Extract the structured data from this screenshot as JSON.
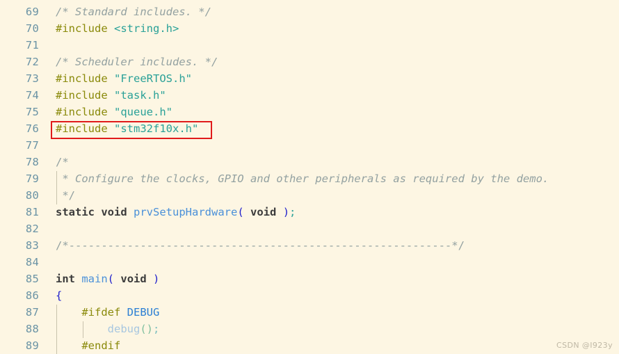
{
  "editor": {
    "background_color": "#fdf6e3",
    "gutter_color": "#6a93a5",
    "highlight_color": "#e01b1b",
    "first_line_number": 69,
    "last_line_number": 89
  },
  "watermark": {
    "text": "CSDN @I923y"
  },
  "lines": [
    {
      "number": "69",
      "text": "/* Standard includes. */"
    },
    {
      "number": "70",
      "text": "#include <string.h>"
    },
    {
      "number": "71",
      "text": ""
    },
    {
      "number": "72",
      "text": "/* Scheduler includes. */"
    },
    {
      "number": "73",
      "text": "#include \"FreeRTOS.h\""
    },
    {
      "number": "74",
      "text": "#include \"task.h\""
    },
    {
      "number": "75",
      "text": "#include \"queue.h\""
    },
    {
      "number": "76",
      "text": "#include \"stm32f10x.h\"",
      "highlighted": true
    },
    {
      "number": "77",
      "text": ""
    },
    {
      "number": "78",
      "text": "/*"
    },
    {
      "number": "79",
      "text": " * Configure the clocks, GPIO and other peripherals as required by the demo."
    },
    {
      "number": "80",
      "text": " */"
    },
    {
      "number": "81",
      "text": "static void prvSetupHardware( void );"
    },
    {
      "number": "82",
      "text": ""
    },
    {
      "number": "83",
      "text": "/*-----------------------------------------------------------*/"
    },
    {
      "number": "84",
      "text": ""
    },
    {
      "number": "85",
      "text": "int main( void )"
    },
    {
      "number": "86",
      "text": "{"
    },
    {
      "number": "87",
      "text": "    #ifdef DEBUG"
    },
    {
      "number": "88",
      "text": "        debug();"
    },
    {
      "number": "89",
      "text": "    #endif"
    }
  ],
  "tokens": {
    "l69": {
      "comment": "/* Standard includes. */"
    },
    "l70": {
      "preproc": "#include",
      "string": "<string.h>"
    },
    "l72": {
      "comment": "/* Scheduler includes. */"
    },
    "l73": {
      "preproc": "#include",
      "string": "\"FreeRTOS.h\""
    },
    "l74": {
      "preproc": "#include",
      "string": "\"task.h\""
    },
    "l75": {
      "preproc": "#include",
      "string": "\"queue.h\""
    },
    "l76": {
      "preproc": "#include",
      "string": "\"stm32f10x.h\""
    },
    "l78": {
      "comment": "/*"
    },
    "l79": {
      "comment": "* Configure the clocks, GPIO and other peripherals as required by the demo."
    },
    "l80": {
      "comment": "*/"
    },
    "l81": {
      "kw1": "static",
      "kw2": "void",
      "func": "prvSetupHardware",
      "open": "(",
      "kw3": "void",
      "close": ")",
      "semi": ";"
    },
    "l83": {
      "comment": "/*-----------------------------------------------------------*/"
    },
    "l85": {
      "kw1": "int",
      "func": "main",
      "open": "(",
      "kw2": "void",
      "close": ")"
    },
    "l86": {
      "brace": "{"
    },
    "l87": {
      "preproc": "#ifdef",
      "macroid": "DEBUG"
    },
    "l88": {
      "dim": "debug",
      "dimparen": "()",
      "dimsemi": ";"
    },
    "l89": {
      "preproc": "#endif"
    }
  }
}
